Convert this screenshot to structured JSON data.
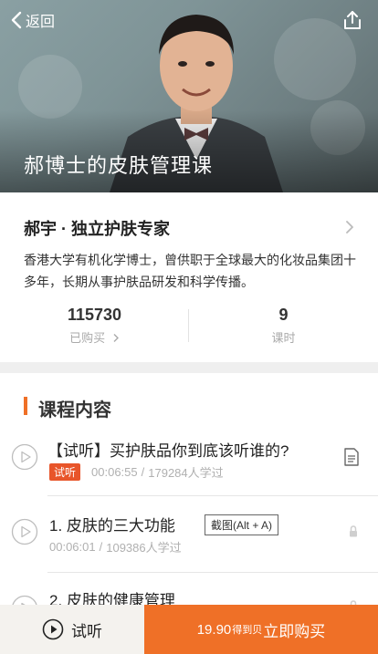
{
  "nav": {
    "back_label": "返回"
  },
  "hero": {
    "title": "郝博士的皮肤管理课"
  },
  "author": {
    "name": "郝宇 · 独立护肤专家",
    "description": "香港大学有机化学博士，曾供职于全球最大的化妆品集团十多年，长期从事护肤品研发和科学传播。"
  },
  "stats": {
    "purchased_count": "115730",
    "purchased_label": "已购买",
    "lessons_count": "9",
    "lessons_label": "课时"
  },
  "section": {
    "title": "课程内容"
  },
  "lessons": [
    {
      "title": "【试听】买护肤品你到底该听谁的?",
      "tag": "试听",
      "duration": "00:06:55",
      "sep": "/",
      "learners": "179284人学过"
    },
    {
      "title": "1. 皮肤的三大功能",
      "duration": "00:06:01",
      "sep": "/",
      "learners": "109386人学过"
    },
    {
      "title": "2. 皮肤的健康管理"
    }
  ],
  "screenshot_tip": "截图(Alt + A)",
  "bottom": {
    "trial_label": "试听",
    "price": "19.90",
    "price_unit": "得到贝",
    "buy_label": "立即购买"
  },
  "colors": {
    "accent": "#ef7027",
    "tag": "#e8552a"
  }
}
